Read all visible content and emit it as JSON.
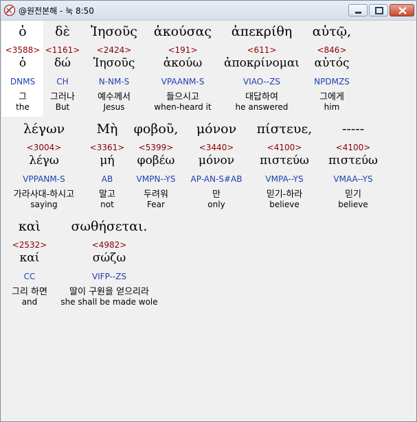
{
  "window": {
    "title": "@원전본해 - 눅 8:50",
    "buttons": {
      "minimize": "minimize",
      "maximize": "maximize",
      "close": "close"
    }
  },
  "colors": {
    "strongs": "#8b0000",
    "morph": "#1f3fb0",
    "highlight": "#ffffff"
  },
  "rows": [
    {
      "words": [
        {
          "greek": "ὁ",
          "strongs": "<3588>",
          "lemma": "ὁ",
          "morph": "DNMS",
          "korean": "그",
          "english": "the"
        },
        {
          "greek": "δὲ",
          "strongs": "<1161>",
          "lemma": "δώ",
          "morph": "CH",
          "korean": "그러나",
          "english": "But"
        },
        {
          "greek": "Ἰησοῦς",
          "strongs": "<2424>",
          "lemma": "Ἰησοῦς",
          "morph": "N-NM-S",
          "korean": "예수께서",
          "english": "Jesus"
        },
        {
          "greek": "ἀκούσας",
          "strongs": "<191>",
          "lemma": "ἀκούω",
          "morph": "VPAANM-S",
          "korean": "들으시고",
          "english": "when-heard it"
        },
        {
          "greek": "ἀπεκρίθη",
          "strongs": "<611>",
          "lemma": "ἀποκρίνομαι",
          "morph": "VIAO--ZS",
          "korean": "대답하여",
          "english": "he answered"
        },
        {
          "greek": "αὐτῷ,",
          "strongs": "<846>",
          "lemma": "αὐτός",
          "morph": "NPDMZS",
          "korean": "그에게",
          "english": "him"
        }
      ]
    },
    {
      "words": [
        {
          "greek": "λέγων",
          "strongs": "<3004>",
          "lemma": "λέγω",
          "morph": "VPPANM-S",
          "korean": "가라사대-하시고",
          "english": "saying"
        },
        {
          "greek": "Μὴ",
          "strongs": "<3361>",
          "lemma": "μή",
          "morph": "AB",
          "korean": "말고",
          "english": "not"
        },
        {
          "greek": "φοβοῦ,",
          "strongs": "<5399>",
          "lemma": "φοβέω",
          "morph": "VMPN--YS",
          "korean": "두려워",
          "english": "Fear"
        },
        {
          "greek": "μόνον",
          "strongs": "<3440>",
          "lemma": "μόνον",
          "morph": "AP-AN-S#AB",
          "korean": "만",
          "english": "only"
        },
        {
          "greek": "πίστευε,",
          "strongs": "<4100>",
          "lemma": "πιστεύω",
          "morph": "VMPA--YS",
          "korean": "믿기-하라",
          "english": "believe"
        },
        {
          "greek": "-----",
          "strongs": "<4100>",
          "lemma": "πιστεύω",
          "morph": "VMAA--YS",
          "korean": "믿기",
          "english": "believe"
        }
      ]
    },
    {
      "words": [
        {
          "greek": "καὶ",
          "strongs": "<2532>",
          "lemma": "καί",
          "morph": "CC",
          "korean": "그리 하면",
          "english": "and"
        },
        {
          "greek": "σωθήσεται.",
          "strongs": "<4982>",
          "lemma": "σώζω",
          "morph": "VIFP--ZS",
          "korean": "딸이 구원을 얻으리라",
          "english": "she shall be made wole"
        }
      ]
    }
  ]
}
